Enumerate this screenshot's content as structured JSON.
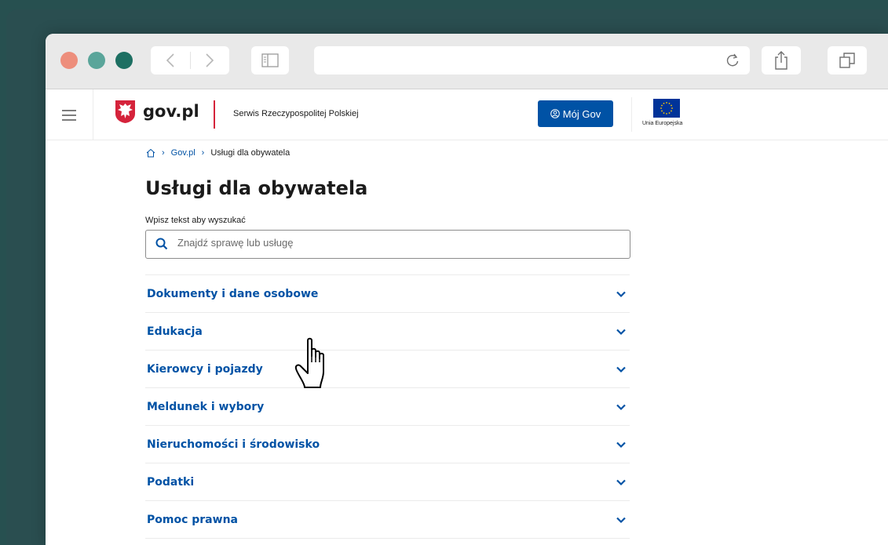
{
  "colors": {
    "backdrop": "#2a4e50",
    "traffic_lights": [
      "#ed8e7c",
      "#5aa59a",
      "#1d6f62"
    ],
    "gov_blue": "#0052a5",
    "gov_red": "#d5233b",
    "eu_blue": "#003399"
  },
  "browser": {
    "icons": [
      "chevron-left-icon",
      "chevron-right-icon",
      "sidebar-icon",
      "reload-icon",
      "share-icon",
      "tabs-icon"
    ]
  },
  "header": {
    "logo": "gov.pl",
    "tagline": "Serwis Rzeczypospolitej Polskiej",
    "login_button": "Mój Gov",
    "eu_label": "Unia Europejska"
  },
  "breadcrumb": {
    "home_icon": "home-icon",
    "items": [
      "Gov.pl",
      "Usługi dla obywatela"
    ]
  },
  "page": {
    "title": "Usługi dla obywatela",
    "search_label": "Wpisz tekst aby wyszukać",
    "search_placeholder": "Znajdź sprawę lub usługę",
    "search_value": ""
  },
  "categories": [
    "Dokumenty i dane osobowe",
    "Edukacja",
    "Kierowcy i pojazdy",
    "Meldunek i wybory",
    "Nieruchomości i środowisko",
    "Podatki",
    "Pomoc prawna"
  ]
}
